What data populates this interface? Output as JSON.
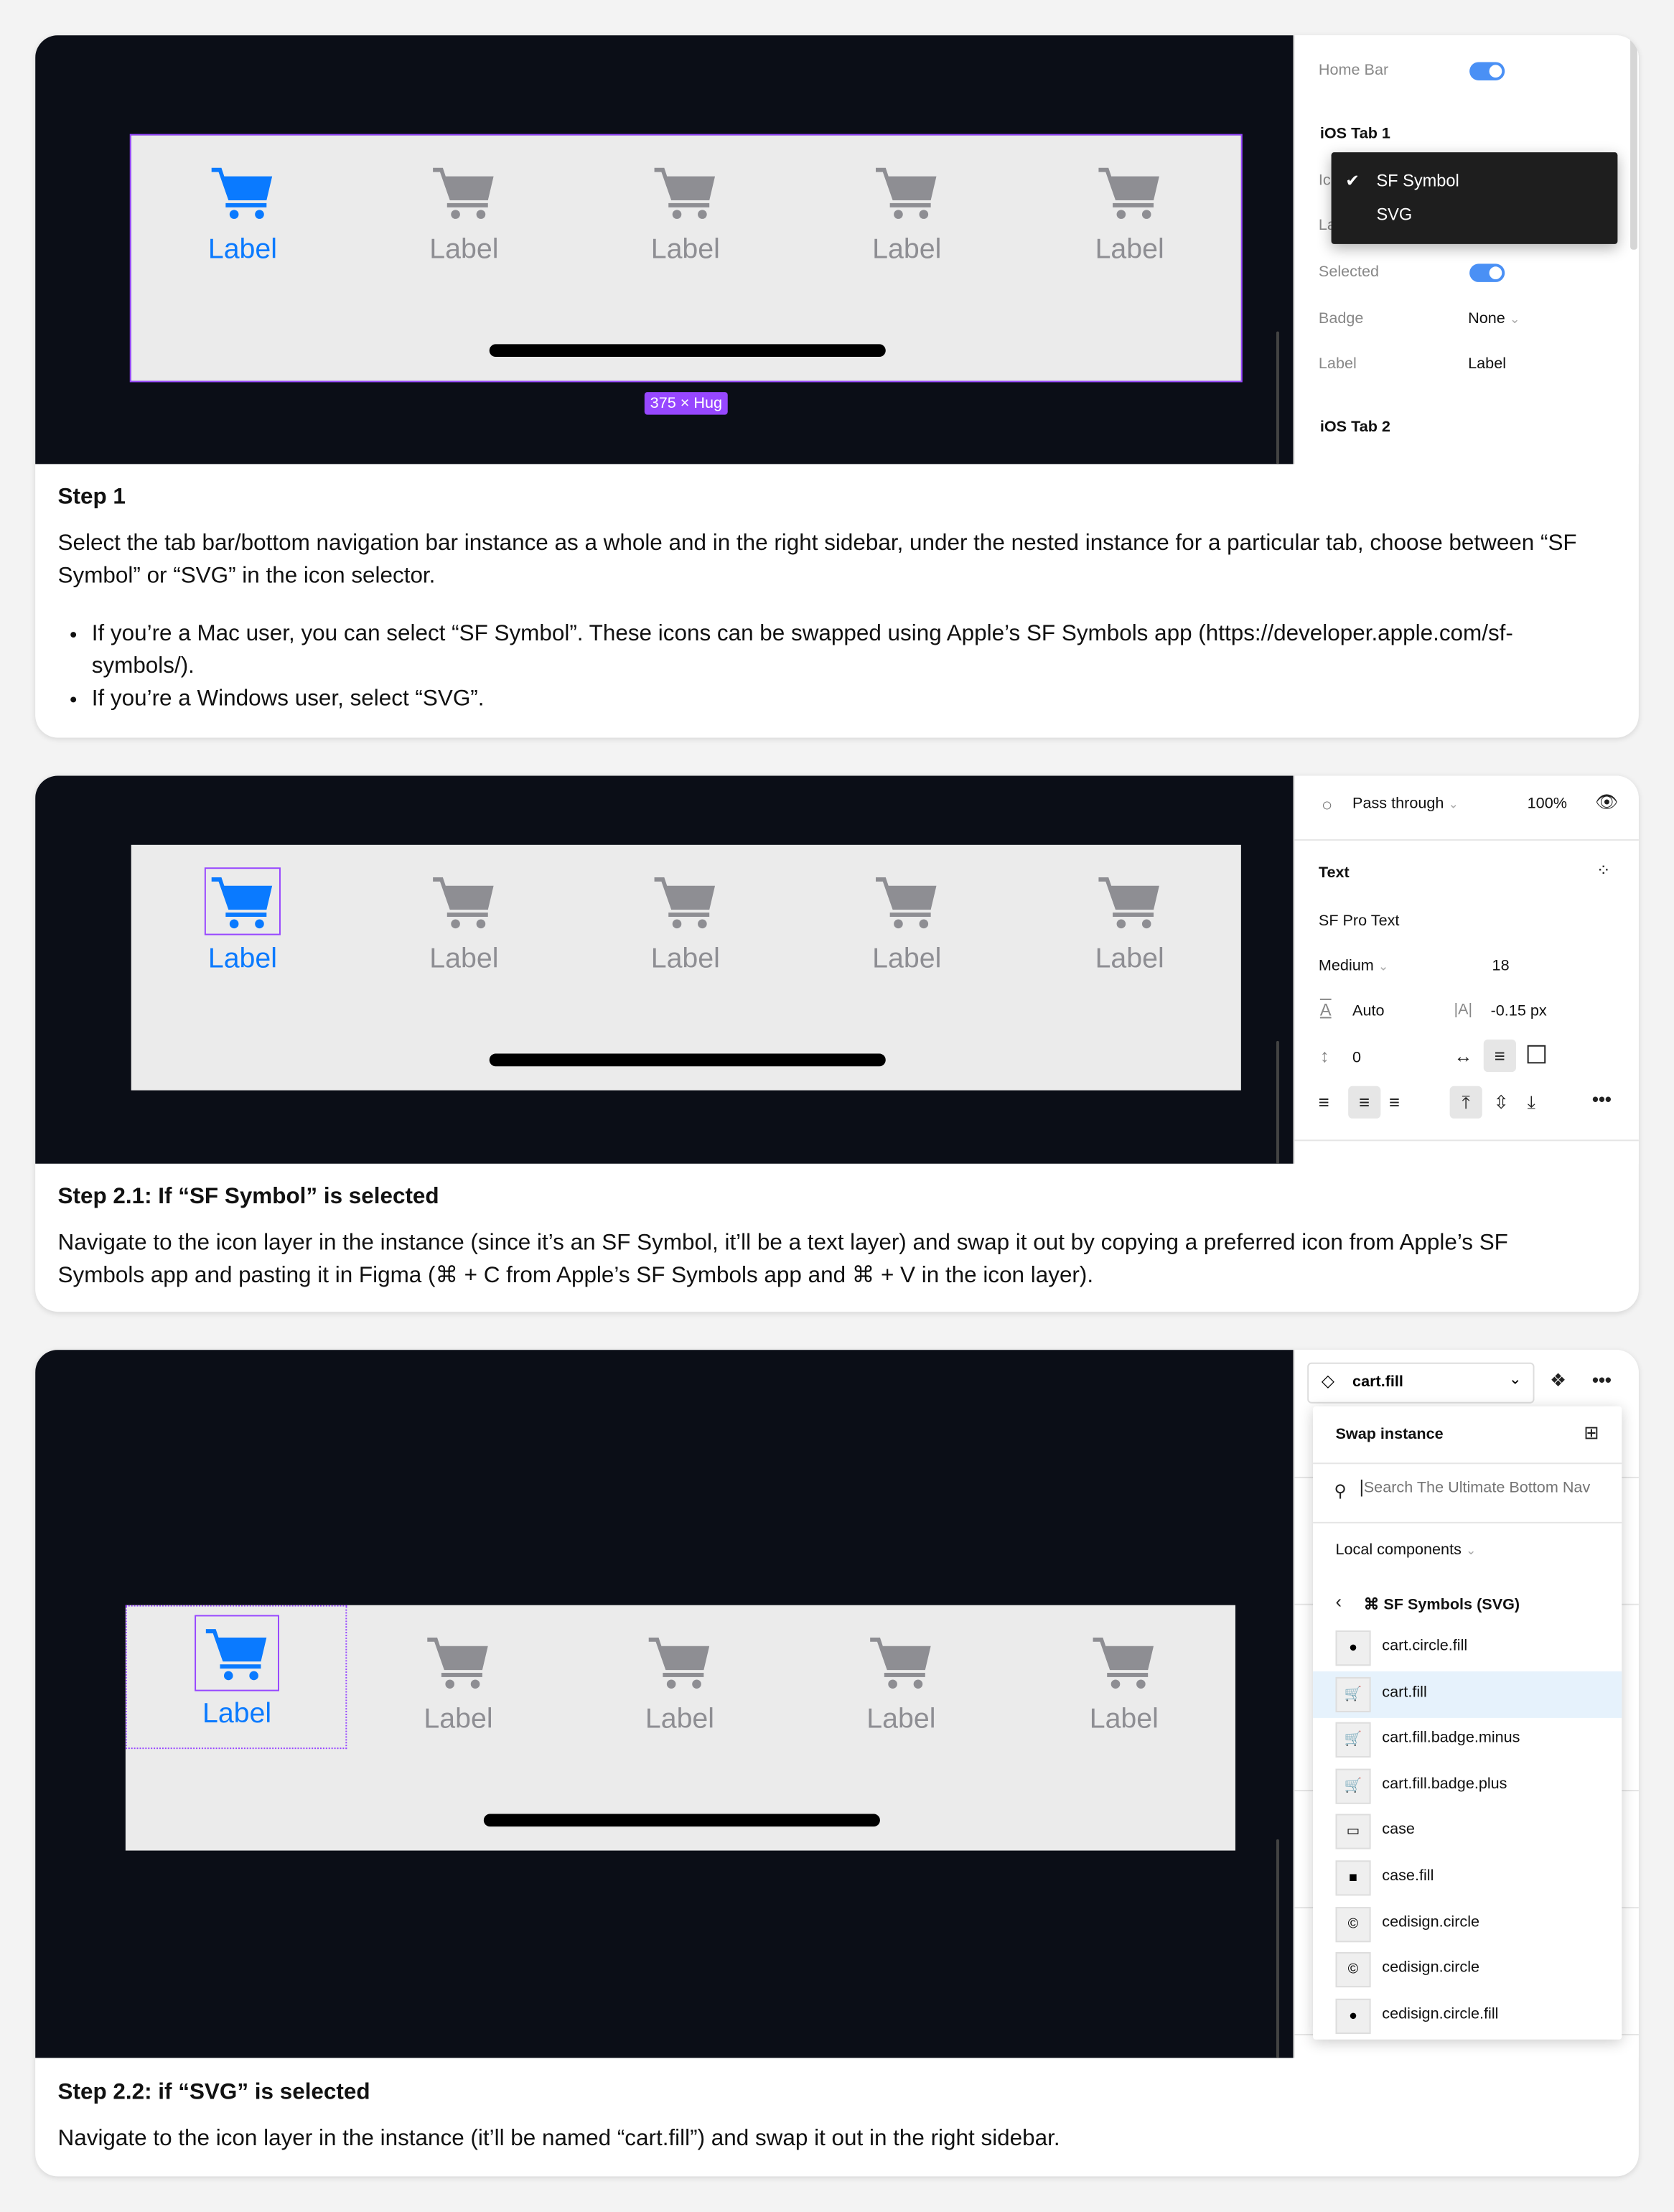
{
  "colors": {
    "accent": "#0a7aff",
    "inactive": "#8e8e93",
    "selection": "#9747ff",
    "canvas": "#0b0e17",
    "toggle": "#4a90f5"
  },
  "tabs": [
    "Label",
    "Label",
    "Label",
    "Label",
    "Label"
  ],
  "step1": {
    "size_badge": "375 × Hug",
    "panel": {
      "home_bar": "Home Bar",
      "home_bar_on": true,
      "section": "iOS Tab 1",
      "icon_label_partial": "Ic",
      "label_partial": "La",
      "menu": [
        {
          "label": "SF Symbol",
          "checked": true
        },
        {
          "label": "SVG",
          "checked": false
        }
      ],
      "selected": "Selected",
      "selected_on": true,
      "badge": "Badge",
      "badge_value": "None",
      "label": "Label",
      "label_value": "Label",
      "section2": "iOS Tab 2"
    },
    "heading": "Step 1",
    "body": "Select the tab bar/bottom navigation bar instance as a whole and in the right sidebar, under the nested instance for a particular tab, choose between “SF Symbol” or “SVG” in the icon selector.",
    "bullets": [
      "If you’re a Mac user, you can select “SF Symbol”. These icons can be swapped using Apple’s SF Symbols app (https://developer.apple.com/sf-symbols/).",
      "If you’re a Windows user, select “SVG”."
    ]
  },
  "step21": {
    "panel": {
      "blend": "Pass through",
      "opacity": "100%",
      "section": "Text",
      "font": "SF Pro Text",
      "weight": "Medium",
      "size": "18",
      "line_height": "Auto",
      "letter_spacing": "-0.15 px",
      "paragraph_spacing": "0"
    },
    "heading": "Step 2.1: If “SF Symbol” is selected",
    "body": "Navigate to the icon layer in the instance (since it’s an SF Symbol, it’ll be a text layer) and swap it out by copying a preferred icon from Apple’s SF Symbols app and pasting it in Figma (⌘ + C from Apple’s SF Symbols app and ⌘ + V in the icon layer)."
  },
  "step22": {
    "panel": {
      "instance": "cart.fill",
      "swap_title": "Swap instance",
      "search_placeholder": "Search The Ultimate Bottom Nav",
      "library": "Local components",
      "folder": "⌘ SF Symbols (SVG)",
      "items": [
        {
          "name": "cart.circle.fill",
          "glyph": "●"
        },
        {
          "name": "cart.fill",
          "glyph": "🛒"
        },
        {
          "name": "cart.fill.badge.minus",
          "glyph": "🛒"
        },
        {
          "name": "cart.fill.badge.plus",
          "glyph": "🛒"
        },
        {
          "name": "case",
          "glyph": "▭"
        },
        {
          "name": "case.fill",
          "glyph": "■"
        },
        {
          "name": "cedisign.circle",
          "glyph": "©"
        },
        {
          "name": "cedisign.circle",
          "glyph": "©"
        },
        {
          "name": "cedisign.circle.fill",
          "glyph": "●"
        }
      ],
      "selected_item": "cart.fill"
    },
    "heading": "Step 2.2: if “SVG” is selected",
    "body": "Navigate to the icon layer in the instance (it’ll be named “cart.fill”) and swap it out in the right sidebar."
  }
}
